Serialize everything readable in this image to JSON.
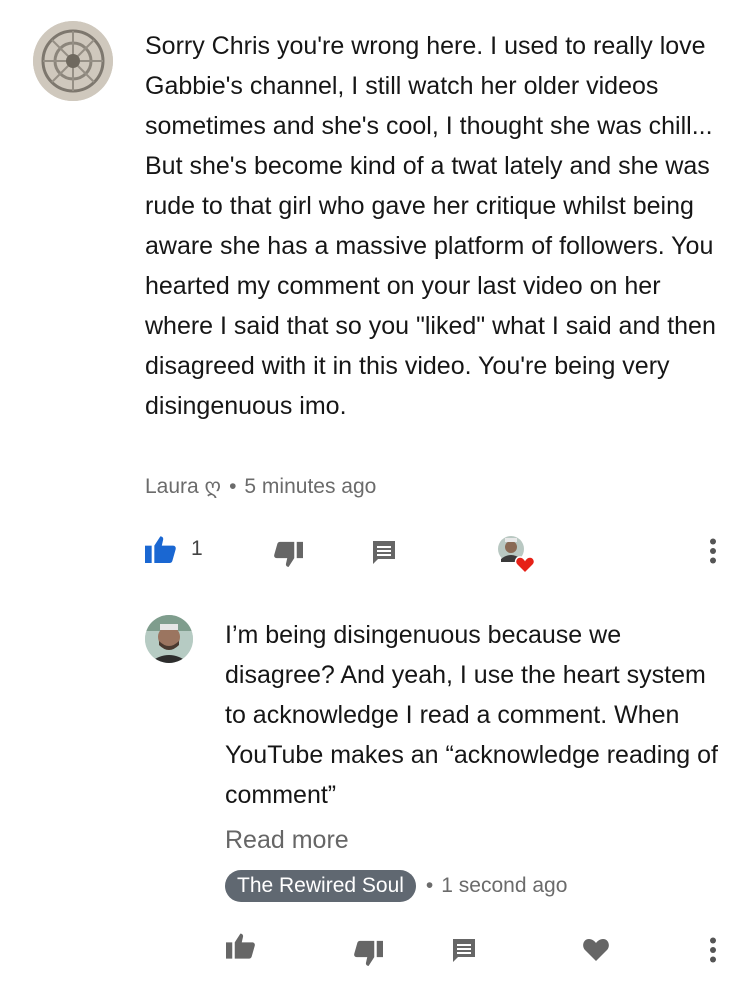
{
  "comment": {
    "text": "Sorry Chris you're wrong here. I used to really love Gabbie's channel, I still watch her older videos sometimes and she's cool, I thought she was chill... But she's become kind of a twat lately and she was rude to that girl who gave her critique whilst being aware she has a massive platform of followers. You hearted my comment on your last video on her where I said that so you \"liked\" what I said and then disagreed with it in this video. You're being very disingenuous imo.",
    "author": "Laura ღ",
    "separator": "•",
    "time": "5 minutes ago",
    "like_count": "1"
  },
  "reply": {
    "text": "I’m being disingenuous because we disagree? And yeah, I use the heart system to acknowledge I read a comment. When YouTube makes an “acknowledge reading of comment”",
    "read_more": "Read more",
    "author": "The Rewired Soul",
    "separator": "•",
    "time": "1 second ago"
  },
  "colors": {
    "like_active": "#1a67d2",
    "icon_gray": "#666666",
    "heart_red": "#e62117",
    "badge_bg": "#606871"
  }
}
